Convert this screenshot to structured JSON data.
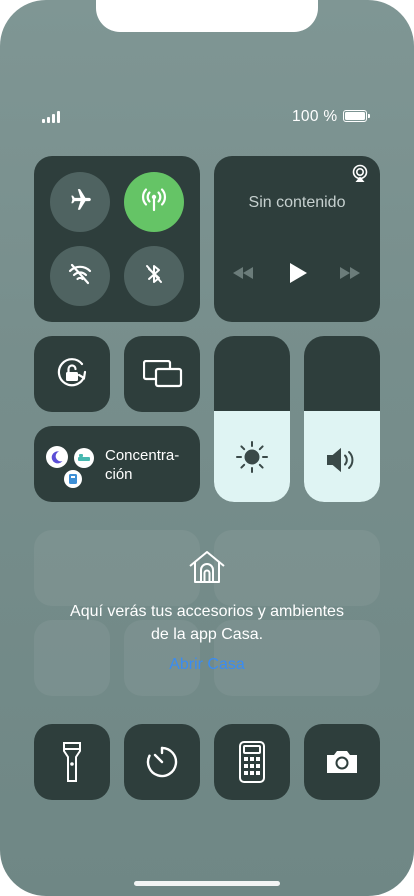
{
  "status_bar": {
    "battery_text": "100 %",
    "battery_level": 1.0,
    "signal_bars": 4
  },
  "connectivity": {
    "airplane": {
      "icon": "airplane-icon",
      "active": false
    },
    "cellular": {
      "icon": "antenna-icon",
      "active": true
    },
    "wifi": {
      "icon": "wifi-off-icon",
      "active": false
    },
    "bluetooth": {
      "icon": "bluetooth-off-icon",
      "active": false
    }
  },
  "media": {
    "title": "Sin contenido",
    "icons": [
      "airplay-icon",
      "rewind-icon",
      "play-icon",
      "fast-forward-icon"
    ]
  },
  "rotation_lock": {
    "icon": "rotation-lock-icon"
  },
  "screen_mirroring": {
    "icon": "screen-mirroring-icon"
  },
  "focus": {
    "label_line1": "Concentra-",
    "label_line2": "ción",
    "icons": [
      "moon-icon",
      "bed-icon",
      "badge-icon"
    ]
  },
  "brightness": {
    "level": 0.55,
    "icon": "sun-icon"
  },
  "volume": {
    "level": 0.55,
    "icon": "speaker-icon"
  },
  "home": {
    "icon": "house-icon",
    "message_line1": "Aquí verás tus accesorios y ambientes",
    "message_line2": "de la app Casa.",
    "link": "Abrir Casa"
  },
  "bottom_controls": [
    {
      "name": "flashlight",
      "icon": "flashlight-icon"
    },
    {
      "name": "timer",
      "icon": "timer-icon"
    },
    {
      "name": "calculator",
      "icon": "calculator-icon"
    },
    {
      "name": "camera",
      "icon": "camera-icon"
    }
  ],
  "colors": {
    "tile": "#2e3e3c",
    "active_green": "#65c466",
    "slider_fill": "#dff4f3",
    "link_blue": "#3a8cf2"
  }
}
